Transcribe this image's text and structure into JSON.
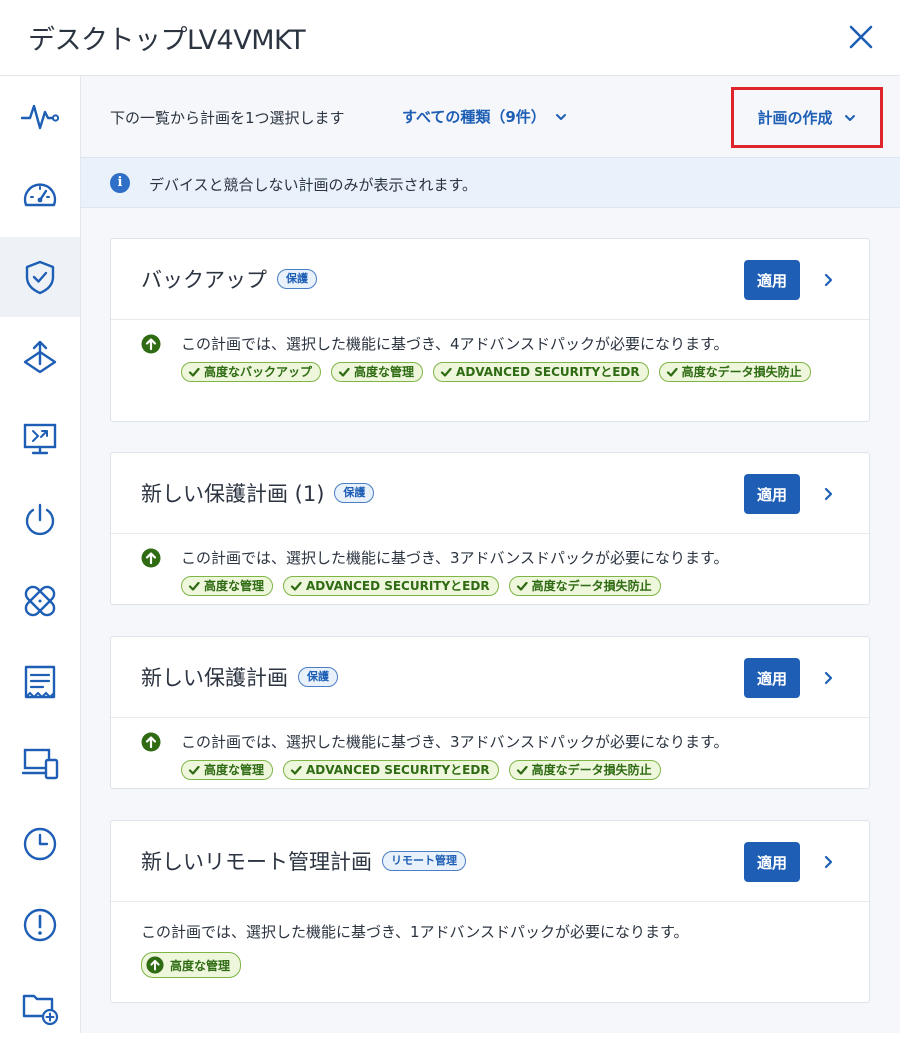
{
  "header": {
    "title": "デスクトップLV4VMKT"
  },
  "toolbar": {
    "label": "下の一覧から計画を1つ選択します",
    "filter": "すべての種類（9件）",
    "create": "計画の作成"
  },
  "info": {
    "text": "デバイスと競合しない計画のみが表示されます。"
  },
  "sidebar": {
    "items": [
      {
        "icon": "activity-icon"
      },
      {
        "icon": "dashboard-icon"
      },
      {
        "icon": "shield-check-icon",
        "active": true
      },
      {
        "icon": "deploy-icon"
      },
      {
        "icon": "remote-desktop-icon"
      },
      {
        "icon": "power-icon"
      },
      {
        "icon": "bandage-icon"
      },
      {
        "icon": "inventory-icon"
      },
      {
        "icon": "devices-icon"
      },
      {
        "icon": "clock-icon"
      },
      {
        "icon": "alert-icon"
      },
      {
        "icon": "folder-add-icon"
      }
    ]
  },
  "cards": [
    {
      "title": "バックアップ",
      "badge": "保護",
      "apply": "適用",
      "requirement": "この計画では、選択した機能に基づき、4アドバンスドパックが必要になります。",
      "tags": [
        "高度なバックアップ",
        "高度な管理",
        "ADVANCED SECURITYとEDR",
        "高度なデータ損失防止"
      ]
    },
    {
      "title": "新しい保護計画 (1)",
      "badge": "保護",
      "apply": "適用",
      "requirement": "この計画では、選択した機能に基づき、3アドバンスドパックが必要になります。",
      "tags": [
        "高度な管理",
        "ADVANCED SECURITYとEDR",
        "高度なデータ損失防止"
      ]
    },
    {
      "title": "新しい保護計画",
      "badge": "保護",
      "apply": "適用",
      "requirement": "この計画では、選択した機能に基づき、3アドバンスドパックが必要になります。",
      "tags": [
        "高度な管理",
        "ADVANCED SECURITYとEDR",
        "高度なデータ損失防止"
      ]
    },
    {
      "title": "新しいリモート管理計画",
      "badge": "リモート管理",
      "apply": "適用",
      "requirement": "この計画では、選択した機能に基づき、1アドバンスドパックが必要になります。",
      "tags": [
        "高度な管理"
      ]
    }
  ],
  "colors": {
    "accent": "#1e5fb5",
    "highlight_border": "#e0242b",
    "tag_green": "#2e6b12"
  }
}
